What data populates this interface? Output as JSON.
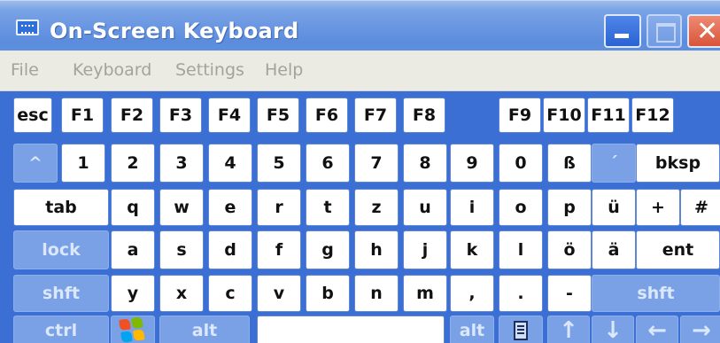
{
  "window": {
    "title": "On-Screen Keyboard"
  },
  "menu": [
    "File",
    "Keyboard",
    "Settings",
    "Help"
  ],
  "keyboard": {
    "function_row": [
      "esc",
      "F1",
      "F2",
      "F3",
      "F4",
      "F5",
      "F6",
      "F7",
      "F8",
      "F9",
      "F10",
      "F11",
      "F12"
    ],
    "number_row": [
      "^",
      "1",
      "2",
      "3",
      "4",
      "5",
      "6",
      "7",
      "8",
      "9",
      "0",
      "ß",
      "´",
      "bksp"
    ],
    "tab_row": [
      "tab",
      "q",
      "w",
      "e",
      "r",
      "t",
      "z",
      "u",
      "i",
      "o",
      "p",
      "ü",
      "+",
      "#"
    ],
    "home_row": [
      "lock",
      "a",
      "s",
      "d",
      "f",
      "g",
      "h",
      "j",
      "k",
      "l",
      "ö",
      "ä",
      "ent"
    ],
    "shift_row": [
      "shft",
      "y",
      "x",
      "c",
      "v",
      "b",
      "n",
      "m",
      ",",
      ".",
      "-",
      "shft"
    ],
    "bottom_row": [
      "ctrl",
      "windows",
      "alt",
      "space",
      "alt",
      "menu",
      "↑",
      "↓",
      "←",
      "→"
    ]
  },
  "colors": {
    "titlebar": "#6a97e2",
    "keyboard_bg": "#3c6fd3",
    "key": "#ffffff",
    "modifier_key": "#7aa0e6",
    "menubar": "#ecebe3"
  }
}
